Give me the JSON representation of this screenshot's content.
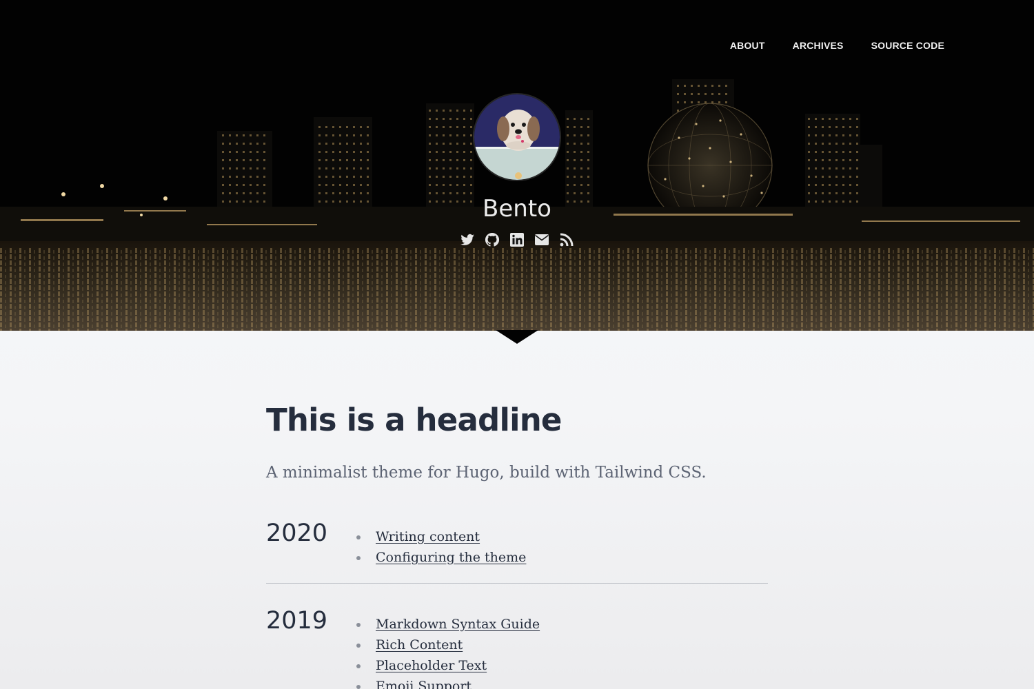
{
  "nav": {
    "links": [
      {
        "label": "ABOUT"
      },
      {
        "label": "ARCHIVES"
      },
      {
        "label": "SOURCE CODE"
      }
    ]
  },
  "profile": {
    "name": "Bento",
    "social_icons": [
      "twitter-icon",
      "github-icon",
      "linkedin-icon",
      "email-icon",
      "rss-icon"
    ]
  },
  "main": {
    "headline": "This is a headline",
    "tagline": "A minimalist theme for Hugo, build with Tailwind CSS.",
    "archive": [
      {
        "year": "2020",
        "posts": [
          "Writing content",
          "Configuring the theme"
        ]
      },
      {
        "year": "2019",
        "posts": [
          "Markdown Syntax Guide",
          "Rich Content",
          "Placeholder Text",
          "Emoji Support"
        ]
      }
    ]
  },
  "colors": {
    "text_dark": "#252d3d",
    "text_muted": "#5c6373",
    "hero_bg": "#020202",
    "city_lights": "#c9a56a"
  }
}
